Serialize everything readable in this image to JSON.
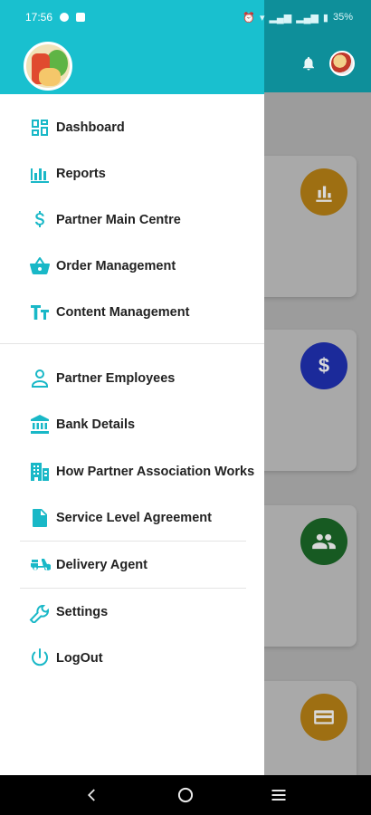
{
  "status_bar": {
    "time": "17:56",
    "battery": "35%"
  },
  "colors": {
    "drawer_header": "#19c0cf",
    "accent": "#19b8c7",
    "card_orange": "#e39b17",
    "card_blue": "#1f2fc8",
    "card_green": "#1f7a2e"
  },
  "menu": {
    "items": [
      {
        "label": "Dashboard",
        "icon": "dashboard-icon"
      },
      {
        "label": "Reports",
        "icon": "bar-chart-icon"
      },
      {
        "label": "Partner Main Centre",
        "icon": "dollar-icon"
      },
      {
        "label": "Order Management",
        "icon": "basket-icon"
      },
      {
        "label": "Content Management",
        "icon": "text-format-icon"
      },
      {
        "label": "Partner Employees",
        "icon": "person-icon"
      },
      {
        "label": "Bank Details",
        "icon": "bank-icon"
      },
      {
        "label": "How Partner Association Works",
        "icon": "building-icon"
      },
      {
        "label": "Service Level Agreement",
        "icon": "document-icon"
      },
      {
        "label": "Delivery Agent",
        "icon": "scooter-icon"
      },
      {
        "label": "Settings",
        "icon": "wrench-icon"
      },
      {
        "label": "LogOut",
        "icon": "power-icon"
      }
    ]
  },
  "background_cards": [
    {
      "icon": "bar-chart-icon",
      "color": "#e39b17"
    },
    {
      "icon": "dollar-icon",
      "color": "#1f2fc8",
      "glyph": "$"
    },
    {
      "icon": "group-icon",
      "color": "#1f7a2e"
    },
    {
      "icon": "card-icon",
      "color": "#e39b17"
    }
  ],
  "navbar": {
    "back": "back-icon",
    "home": "home-icon",
    "recents": "menu-icon"
  }
}
